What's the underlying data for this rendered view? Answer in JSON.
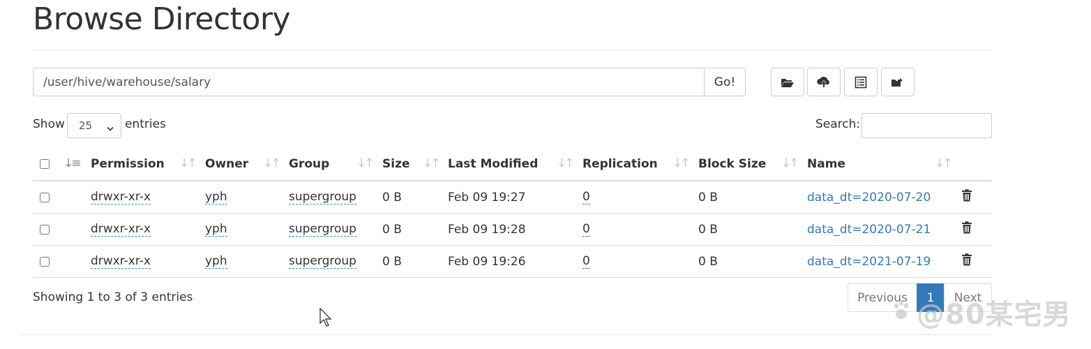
{
  "header": {
    "title": "Browse Directory"
  },
  "path_bar": {
    "path": "/user/hive/warehouse/salary",
    "go_label": "Go!"
  },
  "toolbar": {
    "buttons": [
      {
        "icon": "folder-open-icon"
      },
      {
        "icon": "cloud-upload-icon"
      },
      {
        "icon": "list-alt-icon"
      },
      {
        "icon": "folder-move-icon"
      }
    ]
  },
  "controls": {
    "show_label": "Show",
    "page_length": "25",
    "entries_label": "entries",
    "search_label": "Search:"
  },
  "table": {
    "columns": [
      "Permission",
      "Owner",
      "Group",
      "Size",
      "Last Modified",
      "Replication",
      "Block Size",
      "Name"
    ],
    "rows": [
      {
        "permission": "drwxr-xr-x",
        "owner": "yph",
        "group": "supergroup",
        "size": "0 B",
        "modified": "Feb 09 19:27",
        "replication": "0",
        "block_size": "0 B",
        "name": "data_dt=2020-07-20"
      },
      {
        "permission": "drwxr-xr-x",
        "owner": "yph",
        "group": "supergroup",
        "size": "0 B",
        "modified": "Feb 09 19:28",
        "replication": "0",
        "block_size": "0 B",
        "name": "data_dt=2020-07-21"
      },
      {
        "permission": "drwxr-xr-x",
        "owner": "yph",
        "group": "supergroup",
        "size": "0 B",
        "modified": "Feb 09 19:26",
        "replication": "0",
        "block_size": "0 B",
        "name": "data_dt=2021-07-19"
      }
    ]
  },
  "footer": {
    "info": "Showing 1 to 3 of 3 entries",
    "prev_label": "Previous",
    "current_page": "1",
    "next_label": "Next"
  },
  "watermark": {
    "text": "@80某宅男"
  },
  "colors": {
    "link": "#337ab7",
    "active_page": "#337ab7",
    "border": "#dddddd"
  }
}
